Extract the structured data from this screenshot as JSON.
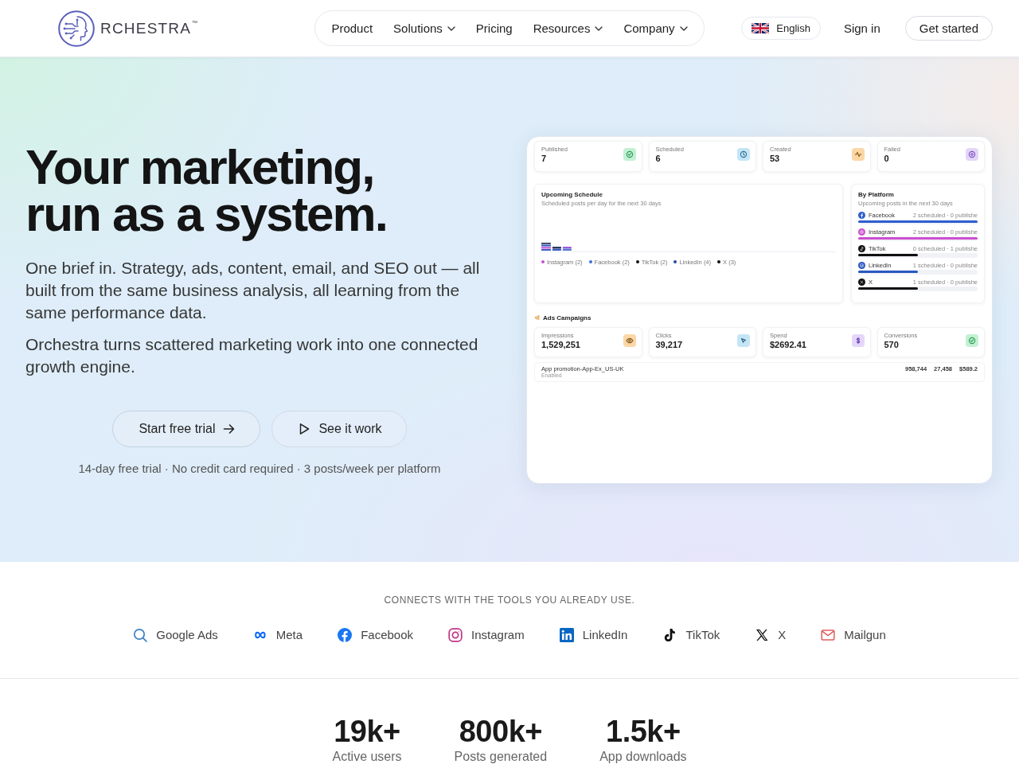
{
  "header": {
    "logo": {
      "text": "RCHESTRA",
      "mark": "™"
    },
    "nav": [
      {
        "label": "Product",
        "dropdown": false
      },
      {
        "label": "Solutions",
        "dropdown": true
      },
      {
        "label": "Pricing",
        "dropdown": false
      },
      {
        "label": "Resources",
        "dropdown": true
      },
      {
        "label": "Company",
        "dropdown": true
      }
    ],
    "language": "English",
    "sign_in": "Sign in",
    "cta": "Get started"
  },
  "hero": {
    "title_lines": [
      "Your marketing,",
      "run as a system."
    ],
    "paragraphs": [
      "One brief in. Strategy, ads, content, email, and SEO out — all built from the same business analysis, all learning from the same performance data.",
      "Orchestra turns scattered marketing work into one connected growth engine."
    ],
    "buttons": [
      {
        "label": "Start free trial",
        "kind": "trial"
      },
      {
        "label": "See it work",
        "kind": "demo"
      }
    ],
    "note": "14-day free trial · No credit card required · 3 posts/week per platform"
  },
  "dashboard": {
    "stats": [
      {
        "label": "Published",
        "value": "7",
        "kind": "published"
      },
      {
        "label": "Scheduled",
        "value": "6",
        "kind": "scheduled"
      },
      {
        "label": "Created",
        "value": "53",
        "kind": "created"
      },
      {
        "label": "Failed",
        "value": "0",
        "kind": "failed"
      }
    ],
    "schedule": {
      "title": "Upcoming Schedule",
      "subtitle": "Scheduled posts per day for the next 30 days",
      "legend": [
        {
          "label": "Instagram (2)",
          "color": "#c84fd8"
        },
        {
          "label": "Facebook (2)",
          "color": "#3b6fd8"
        },
        {
          "label": "TikTok (2)",
          "color": "#111111"
        },
        {
          "label": "LinkedIn (4)",
          "color": "#2548a8"
        },
        {
          "label": "X (3)",
          "color": "#111111"
        }
      ]
    },
    "by_platform": {
      "title": "By Platform",
      "subtitle": "Upcoming posts in the next 30 days",
      "rows": [
        {
          "name": "Facebook",
          "kind": "facebook",
          "status": "2 scheduled · 0 publishe",
          "level": 1,
          "color": "#2f5fcf"
        },
        {
          "name": "Instagram",
          "kind": "instagram",
          "status": "2 scheduled · 0 publishe",
          "level": 1,
          "color": "#cc4fd0"
        },
        {
          "name": "TikTok",
          "kind": "tiktok",
          "status": "0 scheduled · 1 publishe",
          "level": 0.5,
          "color": "#111111"
        },
        {
          "name": "LinkedIn",
          "kind": "linkedin",
          "status": "1 scheduled · 0 publishe",
          "level": 0.5,
          "color": "#2a58c0"
        },
        {
          "name": "X",
          "kind": "x",
          "status": "1 scheduled · 0 publishe",
          "level": 0.5,
          "color": "#111111"
        }
      ]
    },
    "ads": {
      "title": "Ads Campaigns",
      "stats": [
        {
          "label": "Impressions",
          "value": "1,529,251",
          "kind": "impressions"
        },
        {
          "label": "Clicks",
          "value": "39,217",
          "kind": "clicks"
        },
        {
          "label": "Spend",
          "value": "$2692.41",
          "kind": "spend"
        },
        {
          "label": "Conversions",
          "value": "570",
          "kind": "conversions"
        }
      ],
      "campaigns": [
        {
          "name": "App promotion-App-Ex_US-UK",
          "status": "Enabled",
          "metrics": [
            "958,744",
            "27,458",
            "$589.2"
          ]
        }
      ]
    }
  },
  "integrations": {
    "heading": "CONNECTS WITH THE TOOLS YOU ALREADY USE.",
    "items": [
      {
        "name": "Google Ads",
        "kind": "google-ads"
      },
      {
        "name": "Meta",
        "kind": "meta"
      },
      {
        "name": "Facebook",
        "kind": "facebook"
      },
      {
        "name": "Instagram",
        "kind": "instagram"
      },
      {
        "name": "LinkedIn",
        "kind": "linkedin"
      },
      {
        "name": "TikTok",
        "kind": "tiktok"
      },
      {
        "name": "X",
        "kind": "x"
      },
      {
        "name": "Mailgun",
        "kind": "mailgun"
      }
    ]
  },
  "stats": [
    {
      "value": "19k+",
      "label": "Active users"
    },
    {
      "value": "800k+",
      "label": "Posts generated"
    },
    {
      "value": "1.5k+",
      "label": "App downloads"
    }
  ]
}
